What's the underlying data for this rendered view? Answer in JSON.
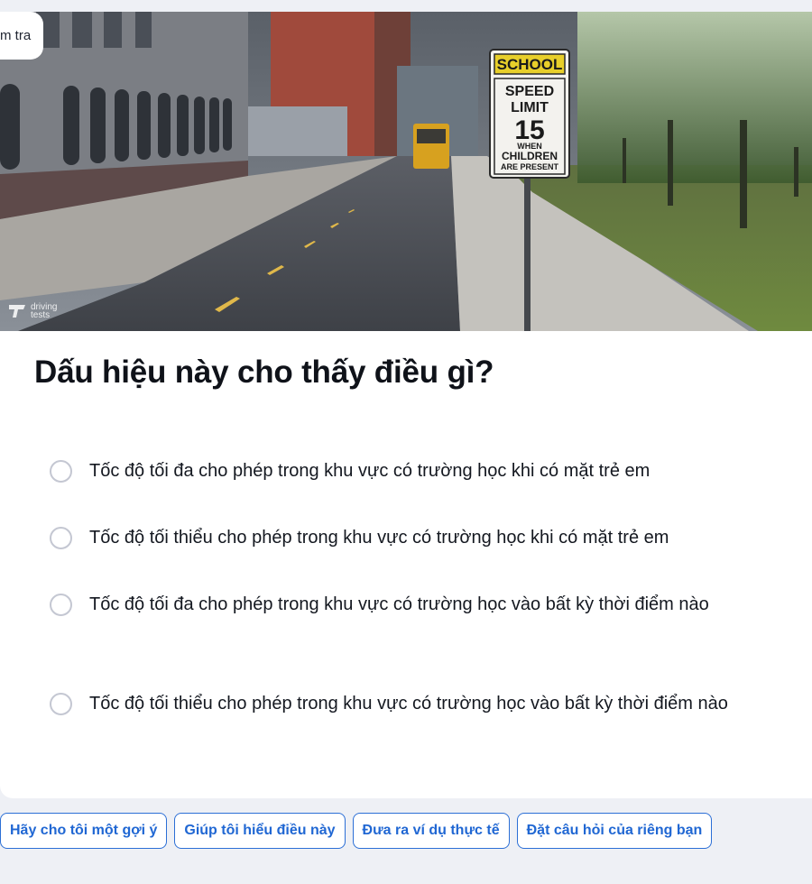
{
  "question": {
    "badge_label": "m tra",
    "title": "Dấu hiệu này cho thấy điều gì?",
    "image": {
      "watermark_line1": "driving",
      "watermark_line2": "tests",
      "sign": {
        "top": "SCHOOL",
        "line1": "SPEED",
        "line2": "LIMIT",
        "number": "15",
        "line3": "WHEN",
        "line4": "CHILDREN",
        "line5": "ARE PRESENT"
      }
    },
    "options": [
      {
        "text": "Tốc độ tối đa cho phép trong khu vực có trường học khi có mặt trẻ em"
      },
      {
        "text": "Tốc độ tối thiểu cho phép trong khu vực có trường học khi có mặt trẻ em"
      },
      {
        "text": "Tốc độ tối đa cho phép trong khu vực có trường học vào bất kỳ thời điểm nào"
      },
      {
        "text": "Tốc độ tối thiểu cho phép trong khu vực có trường học vào bất kỳ thời điểm nào"
      }
    ]
  },
  "actions": {
    "hint": "Hãy cho tôi một gợi ý",
    "explain": "Giúp tôi hiểu điều này",
    "example": "Đưa ra ví dụ thực tế",
    "ask": "Đặt câu hỏi của riêng bạn"
  },
  "colors": {
    "accent": "#2067d3",
    "radio_border": "#c4c7d2",
    "page_bg": "#eef0f5"
  }
}
